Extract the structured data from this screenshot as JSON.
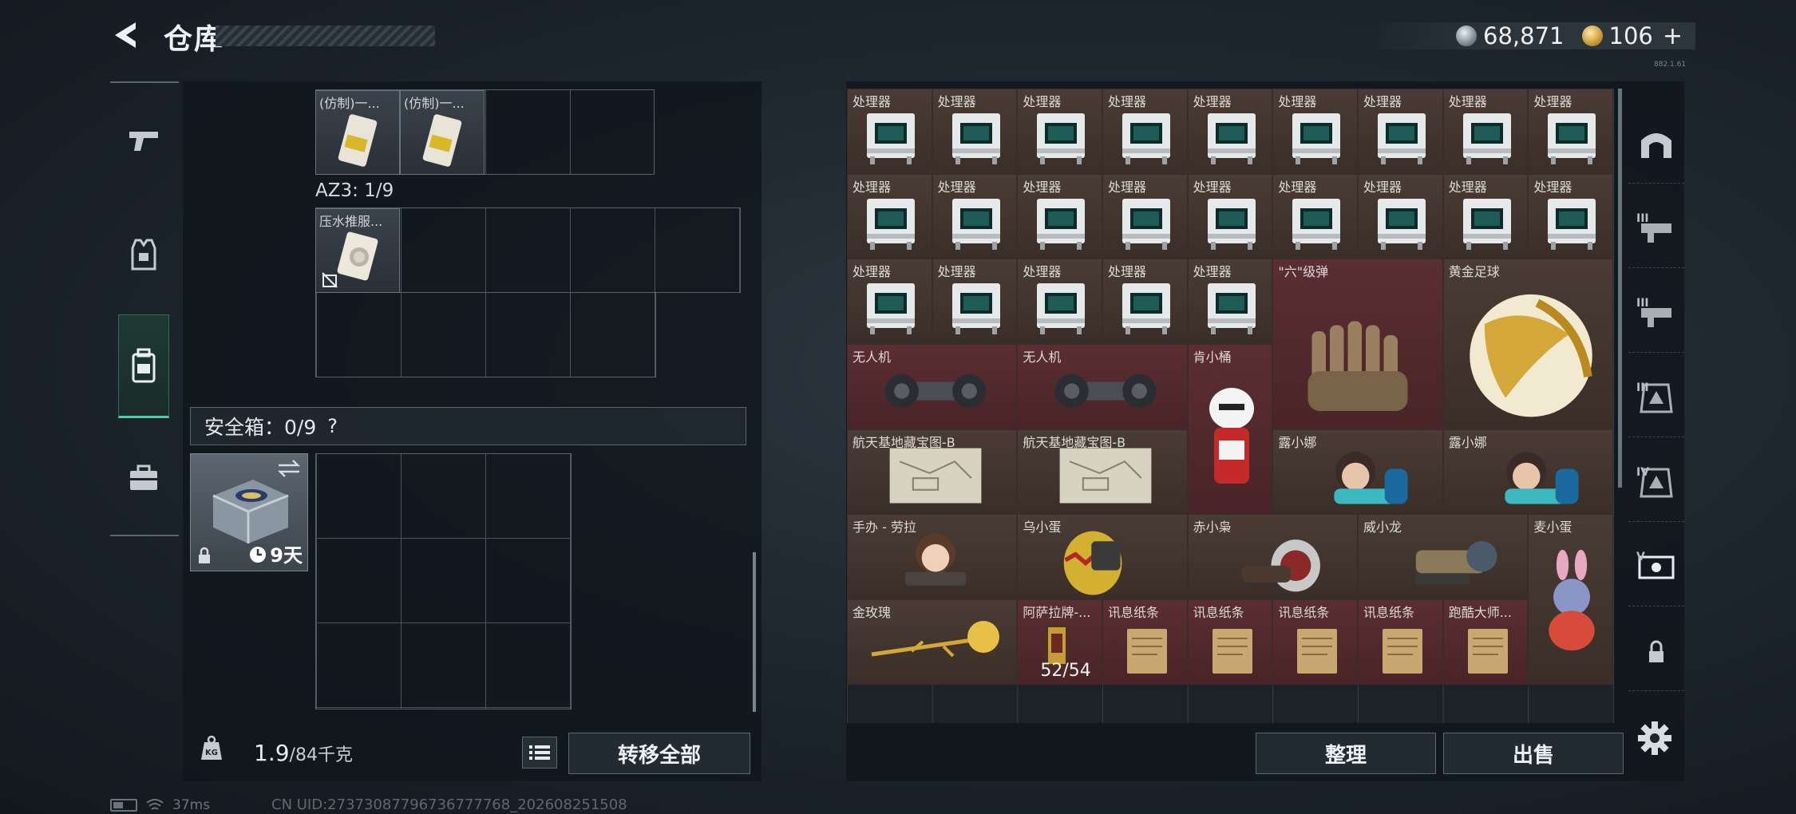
{
  "header": {
    "title": "仓库",
    "back_icon": "back-arrow-icon",
    "currency": {
      "silver_amount": "68,871",
      "gold_amount": "106",
      "plus": "+"
    },
    "sub_text": "882.1.61"
  },
  "left_nav": {
    "items": [
      {
        "name": "weapons",
        "icon": "pistol-icon"
      },
      {
        "name": "armor",
        "icon": "vest-icon"
      },
      {
        "name": "backpack",
        "icon": "backpack-icon",
        "active": true
      },
      {
        "name": "case",
        "icon": "briefcase-icon"
      }
    ]
  },
  "loadout": {
    "container_items": [
      {
        "label": "(仿制)一..."
      },
      {
        "label": "(仿制)一..."
      }
    ],
    "az3_label": "AZ3: 1/9",
    "az3_items": [
      {
        "label": "压水推服..."
      }
    ],
    "safe_box": {
      "label": "安全箱：0/9",
      "help": "?",
      "days": "9天"
    },
    "weight": {
      "value": "1.9",
      "unit": "/84千克"
    },
    "move_all_label": "转移全部"
  },
  "stash": {
    "processor_label": "处理器",
    "items": [
      {
        "label": "\"六\"级弹"
      },
      {
        "label": "黄金足球"
      },
      {
        "label": "无人机"
      },
      {
        "label": "无人机"
      },
      {
        "label": "肯小桶"
      },
      {
        "label": "航天基地藏宝图-B"
      },
      {
        "label": "航天基地藏宝图-B"
      },
      {
        "label": "露小娜"
      },
      {
        "label": "露小娜"
      },
      {
        "label": "手办 - 劳拉"
      },
      {
        "label": "乌小蛋"
      },
      {
        "label": "赤小枭"
      },
      {
        "label": "威小龙"
      },
      {
        "label": "麦小蛋"
      },
      {
        "label": "金玫瑰"
      },
      {
        "label": "阿萨拉牌-...",
        "count": "52/54"
      },
      {
        "label": "讯息纸条"
      },
      {
        "label": "讯息纸条"
      },
      {
        "label": "讯息纸条"
      },
      {
        "label": "讯息纸条"
      },
      {
        "label": "跑酷大师..."
      }
    ],
    "sort_label": "整理",
    "sell_label": "出售"
  },
  "right_nav": {
    "items": [
      {
        "icon": "arch-icon",
        "tag": ""
      },
      {
        "icon": "weapon-tier-icon",
        "tag": "III"
      },
      {
        "icon": "weapon-tier-icon",
        "tag": "III"
      },
      {
        "icon": "armor-tier-icon",
        "tag": "III"
      },
      {
        "icon": "armor-tier-icon",
        "tag": "IV"
      },
      {
        "icon": "ticket-icon",
        "tag": "V"
      },
      {
        "icon": "lock-icon",
        "tag": ""
      }
    ]
  },
  "status": {
    "ping": "37ms",
    "uid": "CN UID:27373087796736777768_202608251508"
  },
  "colors": {
    "accent": "#4ad0a0",
    "item_brown": "#4a3c34",
    "item_red": "#5a2e32"
  }
}
